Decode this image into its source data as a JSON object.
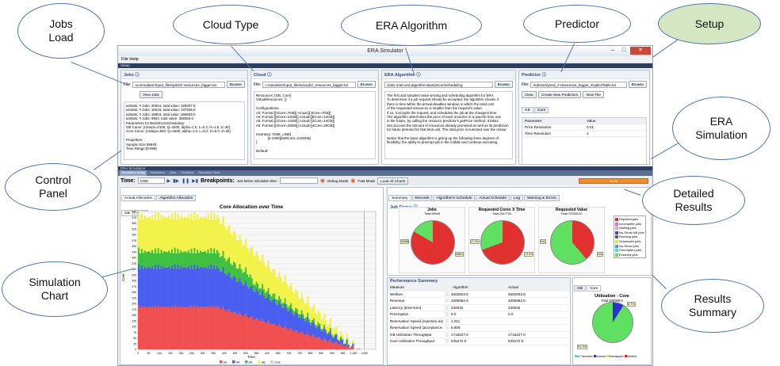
{
  "callouts": {
    "jobs": "Jobs\nLoad",
    "cloud": "Cloud Type",
    "era": "ERA Algorithm",
    "predictor": "Predictor",
    "setup": "Setup",
    "simulation": "ERA\nSimulation",
    "control": "Control\nPanel",
    "detailed": "Detailed\nResults",
    "chart": "Simulation\nChart",
    "results": "Results\nSummary"
  },
  "window": {
    "title": "ERA Simulator",
    "menu": "File  Help",
    "setup_bar": "Setup",
    "sim_bar": "ERA Simulation"
  },
  "jobs": {
    "title": "Jobs",
    "file_label": "File:",
    "file_value": "ra-simulator\\input_files\\jobs\\2 resources_bigger.txt",
    "browse": "Browse",
    "view_jobs": "View Jobs",
    "text": "a3stats: # Jobs: 20044, total value: 329207.0\na1stats: # Jobs: 10016, total value: 337505.0\na2stats: # Jobs: 19903, total value: 359603.0\na4stats: # Jobs: 9924, total value: 358450.0\nParameters for BasicEconScheduling:\nGB Curve: {nSteps=2100, Q=4200, alpha=1.0, L=0.2, H=1.5, Z=30}\nCore Curve: {nSteps=600, Q=1600, alpha=1.0, L=0.2, H=5.0, Z=30}\n\nProperties:\nSample Size:59949\nTime Range:[0-999]"
  },
  "cloud": {
    "title": "Cloud",
    "file_label": "File:",
    "file_value": "c-simulator\\input_files\\cloud\\2_resources_bigger.txt",
    "browse": "Browse",
    "text": "Resources: [GB, Core]\nVirtualResources: {}\n\nConfigurations:\nA3: Formal:{[4Core=7GB]} Actual:{[4Core=7GB]}\nA4: Formal:{[8Core=14GB]} Actual:{[8Core=14GB]}\nA5: Formal:{[2Core=14GB]} Actual:{[2Core=14GB]}\nA6: Formal:{[4Core=28GB]} Actual:{[4Core=28GB]}\n\nInventory: TIME_LINE[\n            [0-1000]{600Core=2100GB}\n}\n\nDefault:"
  },
  "era": {
    "title": "ERA Algorithm",
    "class_value": "class main.era.algorithm.BasicEconScheduling",
    "browse": "Browse",
    "text": "The first and simplest value-pricing and scheduling algorithm for ERA.\nTo determine if a job request should be accepted, the algorithm checks if\nthere is time within the arrival-deadline window, in which the total cost\nof the requested resources is smaller than the request's value.\nIf so, it accepts the request, and schedules the job at the cheapest time.\nThe algorithm determines the price of each resource in a specific time unit\nin the future, by calling the resource predictor's getPrice method. It takes\ninto account the amount of resources already promised as well as its prediction\nfor future demand for that time unit. The total price is summed over the resour\n\nNotice that the basic algorithm is giving up the following three degrees of\nflexibility: the ability to preempt job in the middle and continue executing"
  },
  "predictor": {
    "title": "Predictor",
    "file_label": "File:",
    "file_value": "redictors\\pred_2-resources_bigger_ExplicitTable.txt",
    "browse": "Browse",
    "clear": "Clear",
    "create": "Create New Predictors",
    "view": "View File",
    "tabs": [
      "GB",
      "Core"
    ],
    "col_param": "Parameter",
    "col_value": "Value",
    "rows": [
      {
        "p": "Price Resolution",
        "v": "0.01"
      },
      {
        "p": "Time Resolution",
        "v": "1"
      }
    ]
  },
  "control": {
    "subtabs": [
      "Simulation Setup",
      "Simulation",
      "Jobs",
      "Predictor",
      "Resource View"
    ],
    "time_label": "Time:",
    "time_value": "1000",
    "breakpoints": "Breakpoints:",
    "bp_hint": "Just before simulation time:",
    "debug": "Debug Mode",
    "fast": "Fast Mode",
    "load_charts": "Load All Charts",
    "progress": "100%"
  },
  "chart": {
    "tabs": [
      "Actual Allocation",
      "Algorithm Allocation"
    ],
    "res_tabs": [
      "GB",
      "Core"
    ],
    "title": "Core Allocation over Time",
    "xlabel": "Time",
    "ylabel": "Core",
    "yticks": [
      "600",
      "575",
      "550",
      "525",
      "500",
      "475",
      "450",
      "425",
      "400",
      "375",
      "350",
      "325",
      "300",
      "275",
      "250",
      "225",
      "200",
      "175",
      "150",
      "125",
      "100",
      "75",
      "50",
      "25",
      "0"
    ],
    "xticks": [
      "0",
      "50",
      "100",
      "150",
      "200",
      "250",
      "300",
      "350",
      "400",
      "450",
      "500",
      "550",
      "600",
      "650",
      "700",
      "750",
      "800",
      "850",
      "900",
      "950",
      "1,000",
      "1,050"
    ],
    "legend": [
      {
        "name": "A3",
        "color": "#f05050"
      },
      {
        "name": "A4",
        "color": "#4a5ff0"
      },
      {
        "name": "A5",
        "color": "#40c040"
      },
      {
        "name": "A6",
        "color": "#f2f24a"
      },
      {
        "name": "Core",
        "color": "#cccccc"
      }
    ],
    "marker": "time"
  },
  "detail": {
    "tabs": [
      "Summary",
      "Records",
      "Algorithm's Schedule",
      "Actual Schedule",
      "Log",
      "Warning & Errors"
    ],
    "job_status": "Job Status",
    "pies": [
      {
        "title": "Jobs",
        "total": "Total=59949",
        "red": 300,
        "lbl_left": "25088",
        "lbl_right": "34861"
      },
      {
        "title": "Requested Cores X Time",
        "total": "Total=3317726",
        "red": 250,
        "lbl_left": "27.0%",
        "lbl_right": "73.0%"
      },
      {
        "title": "Requested Value",
        "total": "Total=757635.00",
        "red": 140,
        "lbl_left": "N/A",
        "lbl_right": "N/A"
      }
    ],
    "legend": [
      {
        "name": "Rejected jobs",
        "color": "#e03030"
      },
      {
        "name": "Incomplete jobs",
        "color": "#e060e0"
      },
      {
        "name": "Waiting jobs",
        "color": "#f0a0a0"
      },
      {
        "name": "No-Show-Val jobs",
        "color": "#4040e0"
      },
      {
        "name": "Running jobs",
        "color": "#606060"
      },
      {
        "name": "Scheduled jobs",
        "color": "#e0e040"
      },
      {
        "name": "No-Show jobs",
        "color": "#40a0e0"
      },
      {
        "name": "Preempted jobs",
        "color": "#40e0e0"
      },
      {
        "name": "Finished jobs",
        "color": "#60e060"
      }
    ]
  },
  "summary": {
    "title": "Performance Summary",
    "cols": [
      "Measure",
      "Algorithm",
      "Actual"
    ],
    "rows": [
      {
        "m": "Welfare",
        "a": "4592003.0",
        "b": "4592003.0"
      },
      {
        "m": "Revenue",
        "a": "3300882.5",
        "b": "3300882.5"
      },
      {
        "m": "Latency (time-sum)",
        "a": "430032",
        "b": "430032"
      },
      {
        "m": "Preemption",
        "a": "0.0",
        "b": "0.0"
      },
      {
        "m": "Reservation Speed (rejection avg)",
        "a": "1.211",
        "b": ""
      },
      {
        "m": "Reservation Speed (acceptance avg)",
        "a": "8.808",
        "b": ""
      },
      {
        "m": "GB Utilization Throughput",
        "a": "1718227.0",
        "b": "1718227.0"
      },
      {
        "m": "Core Utilization Throughput",
        "a": "545272.0",
        "b": "545272.0"
      }
    ],
    "util_tabs": [
      "GB",
      "Core"
    ],
    "util_title": "Utilization - Core",
    "util_total": "Total 600000.0",
    "util_legend": [
      "In Transition",
      "Unused",
      "Overlapped",
      "Booked"
    ],
    "util_lbl": "8.7%",
    "util_lbl2": "91.3%"
  }
}
